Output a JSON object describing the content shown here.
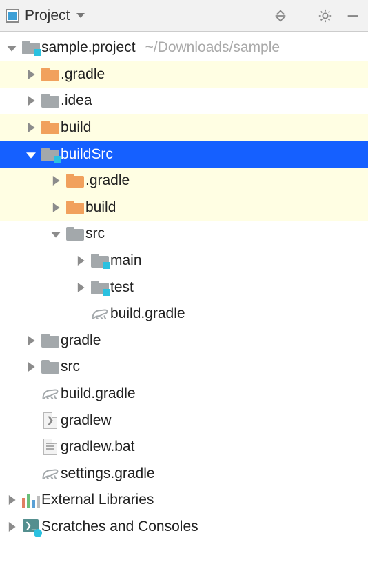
{
  "toolbar": {
    "view_label": "Project"
  },
  "tree": {
    "root": {
      "label": "sample.project",
      "hint": "~/Downloads/sample"
    },
    "nodes": {
      "gradle_dir": ".gradle",
      "idea_dir": ".idea",
      "build_dir": "build",
      "buildSrc": "buildSrc",
      "buildSrc_gradle": ".gradle",
      "buildSrc_build": "build",
      "buildSrc_src": "src",
      "buildSrc_src_main": "main",
      "buildSrc_src_test": "test",
      "buildSrc_build_gradle": "build.gradle",
      "gradle_folder": "gradle",
      "src": "src",
      "build_gradle": "build.gradle",
      "gradlew": "gradlew",
      "gradlew_bat": "gradlew.bat",
      "settings_gradle": "settings.gradle"
    },
    "external_libs": "External Libraries",
    "scratches": "Scratches and Consoles"
  }
}
